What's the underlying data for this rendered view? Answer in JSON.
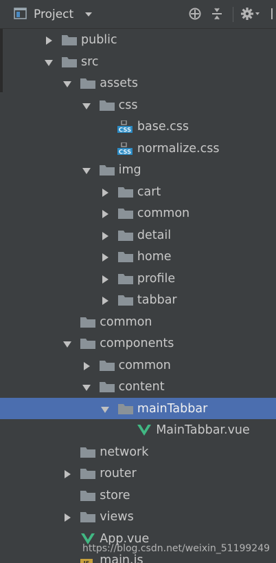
{
  "header": {
    "title": "Project"
  },
  "tree": [
    {
      "label": "public",
      "type": "folder",
      "expand": "collapsed",
      "depth": 0,
      "name": "public"
    },
    {
      "label": "src",
      "type": "folder",
      "expand": "expanded",
      "depth": 0,
      "name": "src"
    },
    {
      "label": "assets",
      "type": "folder",
      "expand": "expanded",
      "depth": 1,
      "name": "assets"
    },
    {
      "label": "css",
      "type": "folder",
      "expand": "expanded",
      "depth": 2,
      "name": "css"
    },
    {
      "label": "base.css",
      "type": "css",
      "expand": "none",
      "depth": 3,
      "name": "base-css"
    },
    {
      "label": "normalize.css",
      "type": "css",
      "expand": "none",
      "depth": 3,
      "name": "normalize-css"
    },
    {
      "label": "img",
      "type": "folder",
      "expand": "expanded",
      "depth": 2,
      "name": "img"
    },
    {
      "label": "cart",
      "type": "folder",
      "expand": "collapsed",
      "depth": 3,
      "name": "cart"
    },
    {
      "label": "common",
      "type": "folder",
      "expand": "collapsed",
      "depth": 3,
      "name": "img-common"
    },
    {
      "label": "detail",
      "type": "folder",
      "expand": "collapsed",
      "depth": 3,
      "name": "detail"
    },
    {
      "label": "home",
      "type": "folder",
      "expand": "collapsed",
      "depth": 3,
      "name": "home"
    },
    {
      "label": "profile",
      "type": "folder",
      "expand": "collapsed",
      "depth": 3,
      "name": "profile"
    },
    {
      "label": "tabbar",
      "type": "folder",
      "expand": "collapsed",
      "depth": 3,
      "name": "tabbar"
    },
    {
      "label": "common",
      "type": "folder",
      "expand": "none",
      "depth": 1,
      "name": "src-common"
    },
    {
      "label": "components",
      "type": "folder",
      "expand": "expanded",
      "depth": 1,
      "name": "components"
    },
    {
      "label": "common",
      "type": "folder",
      "expand": "collapsed",
      "depth": 2,
      "name": "components-common"
    },
    {
      "label": "content",
      "type": "folder",
      "expand": "expanded",
      "depth": 2,
      "name": "content"
    },
    {
      "label": "mainTabbar",
      "type": "folder",
      "expand": "expanded",
      "depth": 3,
      "name": "mainTabbar",
      "selected": true
    },
    {
      "label": "MainTabbar.vue",
      "type": "vue",
      "expand": "none",
      "depth": 4,
      "name": "mainTabbar-vue"
    },
    {
      "label": "network",
      "type": "folder",
      "expand": "none",
      "depth": 1,
      "name": "network"
    },
    {
      "label": "router",
      "type": "folder",
      "expand": "collapsed",
      "depth": 1,
      "name": "router"
    },
    {
      "label": "store",
      "type": "folder",
      "expand": "none",
      "depth": 1,
      "name": "store"
    },
    {
      "label": "views",
      "type": "folder",
      "expand": "collapsed",
      "depth": 1,
      "name": "views"
    },
    {
      "label": "App.vue",
      "type": "vue",
      "expand": "none",
      "depth": 1,
      "name": "app-vue"
    },
    {
      "label": "main.js",
      "type": "js",
      "expand": "none",
      "depth": 1,
      "name": "main-js"
    }
  ],
  "watermark": "https://blog.csdn.net/weixin_51199249",
  "icons": {
    "project": "project-icon",
    "dropdown": "chevron-down-icon",
    "locate": "crosshair-icon",
    "collapse": "collapse-all-icon",
    "settings": "gear-icon"
  },
  "colors": {
    "background": "#3c3f41",
    "selection": "#4b6eaf",
    "folder": "#8a9298",
    "vue": "#41b883",
    "css_badge": "#2b8bc4",
    "js_badge": "#c7a03c"
  }
}
